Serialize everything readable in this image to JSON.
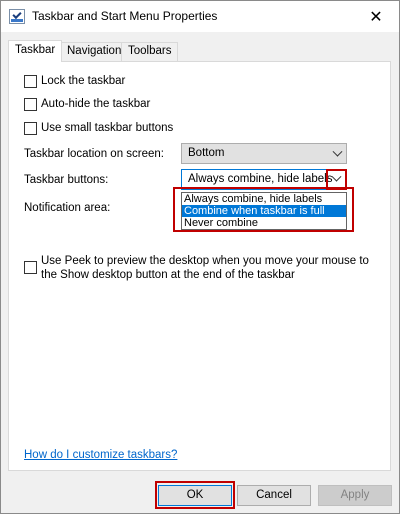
{
  "window": {
    "title": "Taskbar and Start Menu Properties",
    "close_glyph": "✕"
  },
  "tabs": [
    {
      "label": "Taskbar",
      "active": true
    },
    {
      "label": "Navigation",
      "active": false
    },
    {
      "label": "Toolbars",
      "active": false
    }
  ],
  "checkboxes": {
    "lock": "Lock the taskbar",
    "autohide": "Auto-hide the taskbar",
    "small": "Use small taskbar buttons"
  },
  "location": {
    "label": "Taskbar location on screen:",
    "value": "Bottom"
  },
  "buttons_setting": {
    "label": "Taskbar buttons:",
    "value": "Always combine, hide labels",
    "options": [
      "Always combine, hide labels",
      "Combine when taskbar is full",
      "Never combine"
    ],
    "highlighted": "Combine when taskbar is full"
  },
  "notification": {
    "label": "Notification area:"
  },
  "peek": {
    "label": "Use Peek to preview the desktop when you move your mouse to the Show desktop button at the end of the taskbar"
  },
  "help_link": "How do I customize taskbars?",
  "footer": {
    "ok": "OK",
    "cancel": "Cancel",
    "apply": "Apply"
  },
  "colors": {
    "highlight": "#0078d7",
    "annotation": "#c00000",
    "link": "#0066cc"
  }
}
